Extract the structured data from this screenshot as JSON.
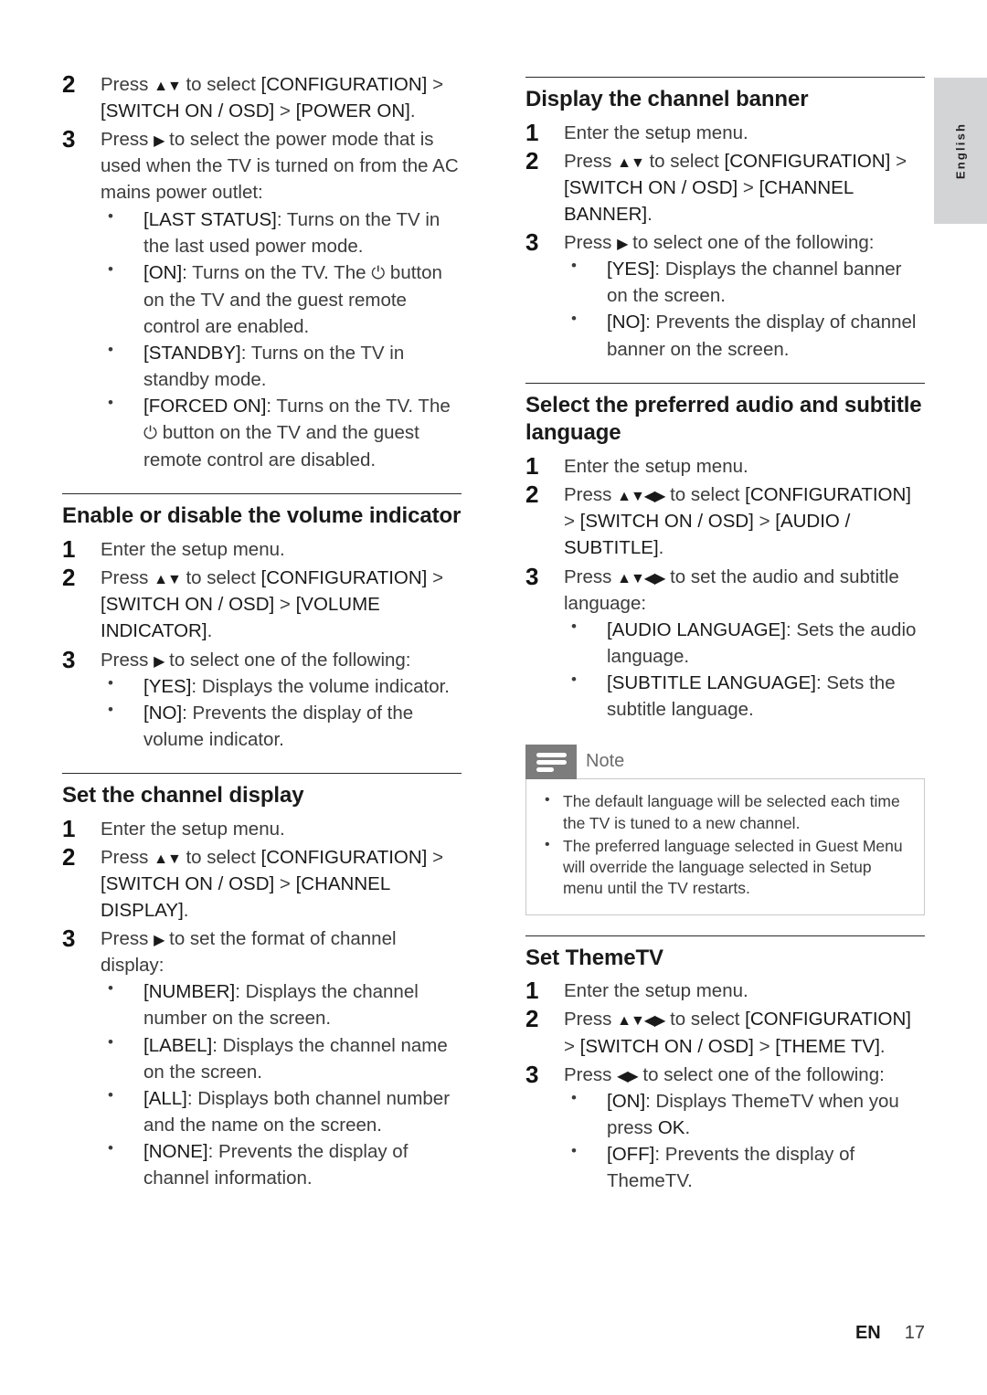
{
  "language_tab": {
    "label": "English"
  },
  "footer": {
    "lang_code": "EN",
    "page_number": "17"
  },
  "symbols": {
    "up_down": "▲▼",
    "right": "▶",
    "left_right": "◀▶",
    "all_dirs": "▲▼◀▶",
    "power": "⏻"
  },
  "left_column": {
    "continued_steps": [
      {
        "num": "2",
        "text": "Press ▲▼ to select [CONFIGURATION] > [SWITCH ON / OSD] > [POWER ON]."
      },
      {
        "num": "3",
        "text": "Press ▶ to select the power mode that is used when the TV is turned on from the AC mains power outlet:",
        "bullets": [
          "[LAST STATUS]: Turns on the TV in the last used power mode.",
          "[ON]: Turns on the TV. The ⏻ button on the TV and the guest remote control are enabled.",
          "[STANDBY]: Turns on the TV in standby mode.",
          "[FORCED ON]: Turns on the TV. The ⏻ button on the TV and the guest remote control are disabled."
        ]
      }
    ],
    "sections": [
      {
        "title": "Enable or disable the volume indicator",
        "steps": [
          {
            "num": "1",
            "text": "Enter the setup menu."
          },
          {
            "num": "2",
            "text": "Press ▲▼ to select [CONFIGURATION] > [SWITCH ON / OSD] > [VOLUME INDICATOR]."
          },
          {
            "num": "3",
            "text": "Press ▶ to select one of the following:",
            "bullets": [
              "[YES]: Displays the volume indicator.",
              "[NO]: Prevents the display of the volume indicator."
            ]
          }
        ]
      },
      {
        "title": "Set the channel display",
        "steps": [
          {
            "num": "1",
            "text": "Enter the setup menu."
          },
          {
            "num": "2",
            "text": "Press ▲▼ to select [CONFIGURATION] > [SWITCH ON / OSD] > [CHANNEL DISPLAY]."
          },
          {
            "num": "3",
            "text": "Press ▶ to set the format of channel display:",
            "bullets": [
              "[NUMBER]: Displays the channel number on the screen.",
              "[LABEL]: Displays the channel name on the screen.",
              "[ALL]: Displays both channel number and the name on the screen.",
              "[NONE]: Prevents the display of channel information."
            ]
          }
        ]
      }
    ]
  },
  "right_column": {
    "sections": [
      {
        "title": "Display the channel banner",
        "steps": [
          {
            "num": "1",
            "text": "Enter the setup menu."
          },
          {
            "num": "2",
            "text": "Press ▲▼ to select [CONFIGURATION] > [SWITCH ON / OSD] > [CHANNEL BANNER]."
          },
          {
            "num": "3",
            "text": "Press ▶ to select one of the following:",
            "bullets": [
              "[YES]: Displays the channel banner on the screen.",
              "[NO]: Prevents the display of channel banner on the screen."
            ]
          }
        ]
      },
      {
        "title": "Select the preferred audio and subtitle language",
        "steps": [
          {
            "num": "1",
            "text": "Enter the setup menu."
          },
          {
            "num": "2",
            "text": "Press ▲▼◀▶ to select [CONFIGURATION] > [SWITCH ON / OSD] > [AUDIO / SUBTITLE]."
          },
          {
            "num": "3",
            "text": "Press ▲▼◀▶ to set the audio and subtitle language:",
            "bullets": [
              "[AUDIO LANGUAGE]: Sets the audio language.",
              "[SUBTITLE LANGUAGE]: Sets the subtitle language."
            ]
          }
        ]
      },
      {
        "title": "Set ThemeTV",
        "steps": [
          {
            "num": "1",
            "text": "Enter the setup menu."
          },
          {
            "num": "2",
            "text": "Press ▲▼◀▶ to select [CONFIGURATION] > [SWITCH ON / OSD] > [THEME TV]."
          },
          {
            "num": "3",
            "text": "Press ◀▶ to select one of the following:",
            "bullets": [
              "[ON]: Displays ThemeTV when you press OK.",
              "[OFF]: Prevents the display of ThemeTV."
            ]
          }
        ]
      }
    ],
    "note": {
      "icon": "note-lines-icon",
      "label": "Note",
      "items": [
        "The default language will be selected each time the TV is tuned to a new channel.",
        "The preferred language selected in Guest Menu will override the language selected in Setup menu until the TV restarts."
      ]
    }
  }
}
